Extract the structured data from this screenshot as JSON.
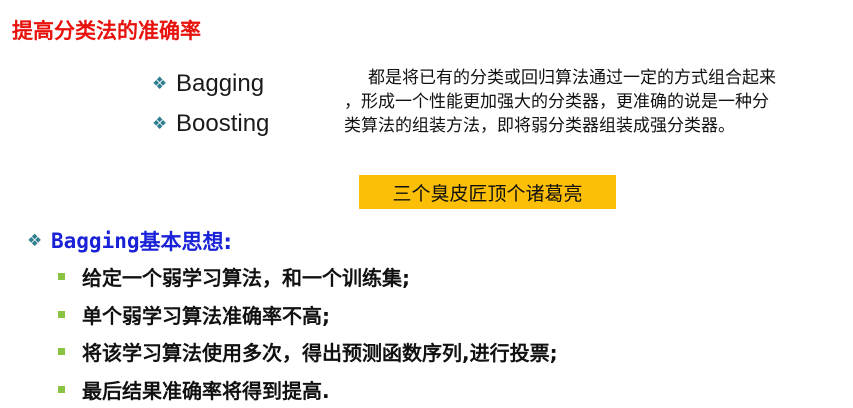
{
  "slide": {
    "title": "提高分类法的准确率",
    "top_items": [
      "Bagging",
      "Boosting"
    ],
    "description_lines": [
      "都是将已有的分类或回归算法通过一定的方式组合起来",
      "，形成一个性能更加强大的分类器，更准确的说是一种分",
      "类算法的组装方法，即将弱分类器组装成强分类器。"
    ],
    "highlight": "三个臭皮匠顶个诸葛亮",
    "section_title_latin": "Bagging",
    "section_title_rest": "基本思想:",
    "bullets": [
      "给定一个弱学习算法，和一个训练集;",
      "单个弱学习算法准确率不高;",
      "将该学习算法使用多次，得出预测函数序列,进行投票;",
      "最后结果准确率将得到提高."
    ]
  },
  "icons": {
    "diamond": "diamond-bullet-icon",
    "square": "square-bullet-icon"
  },
  "colors": {
    "title": "#e8120c",
    "section_title": "#1a22d8",
    "diamond_bullet": "#2f7f8f",
    "square_bullet": "#89c341",
    "highlight_bg": "#fbbf07",
    "text": "#111111"
  }
}
